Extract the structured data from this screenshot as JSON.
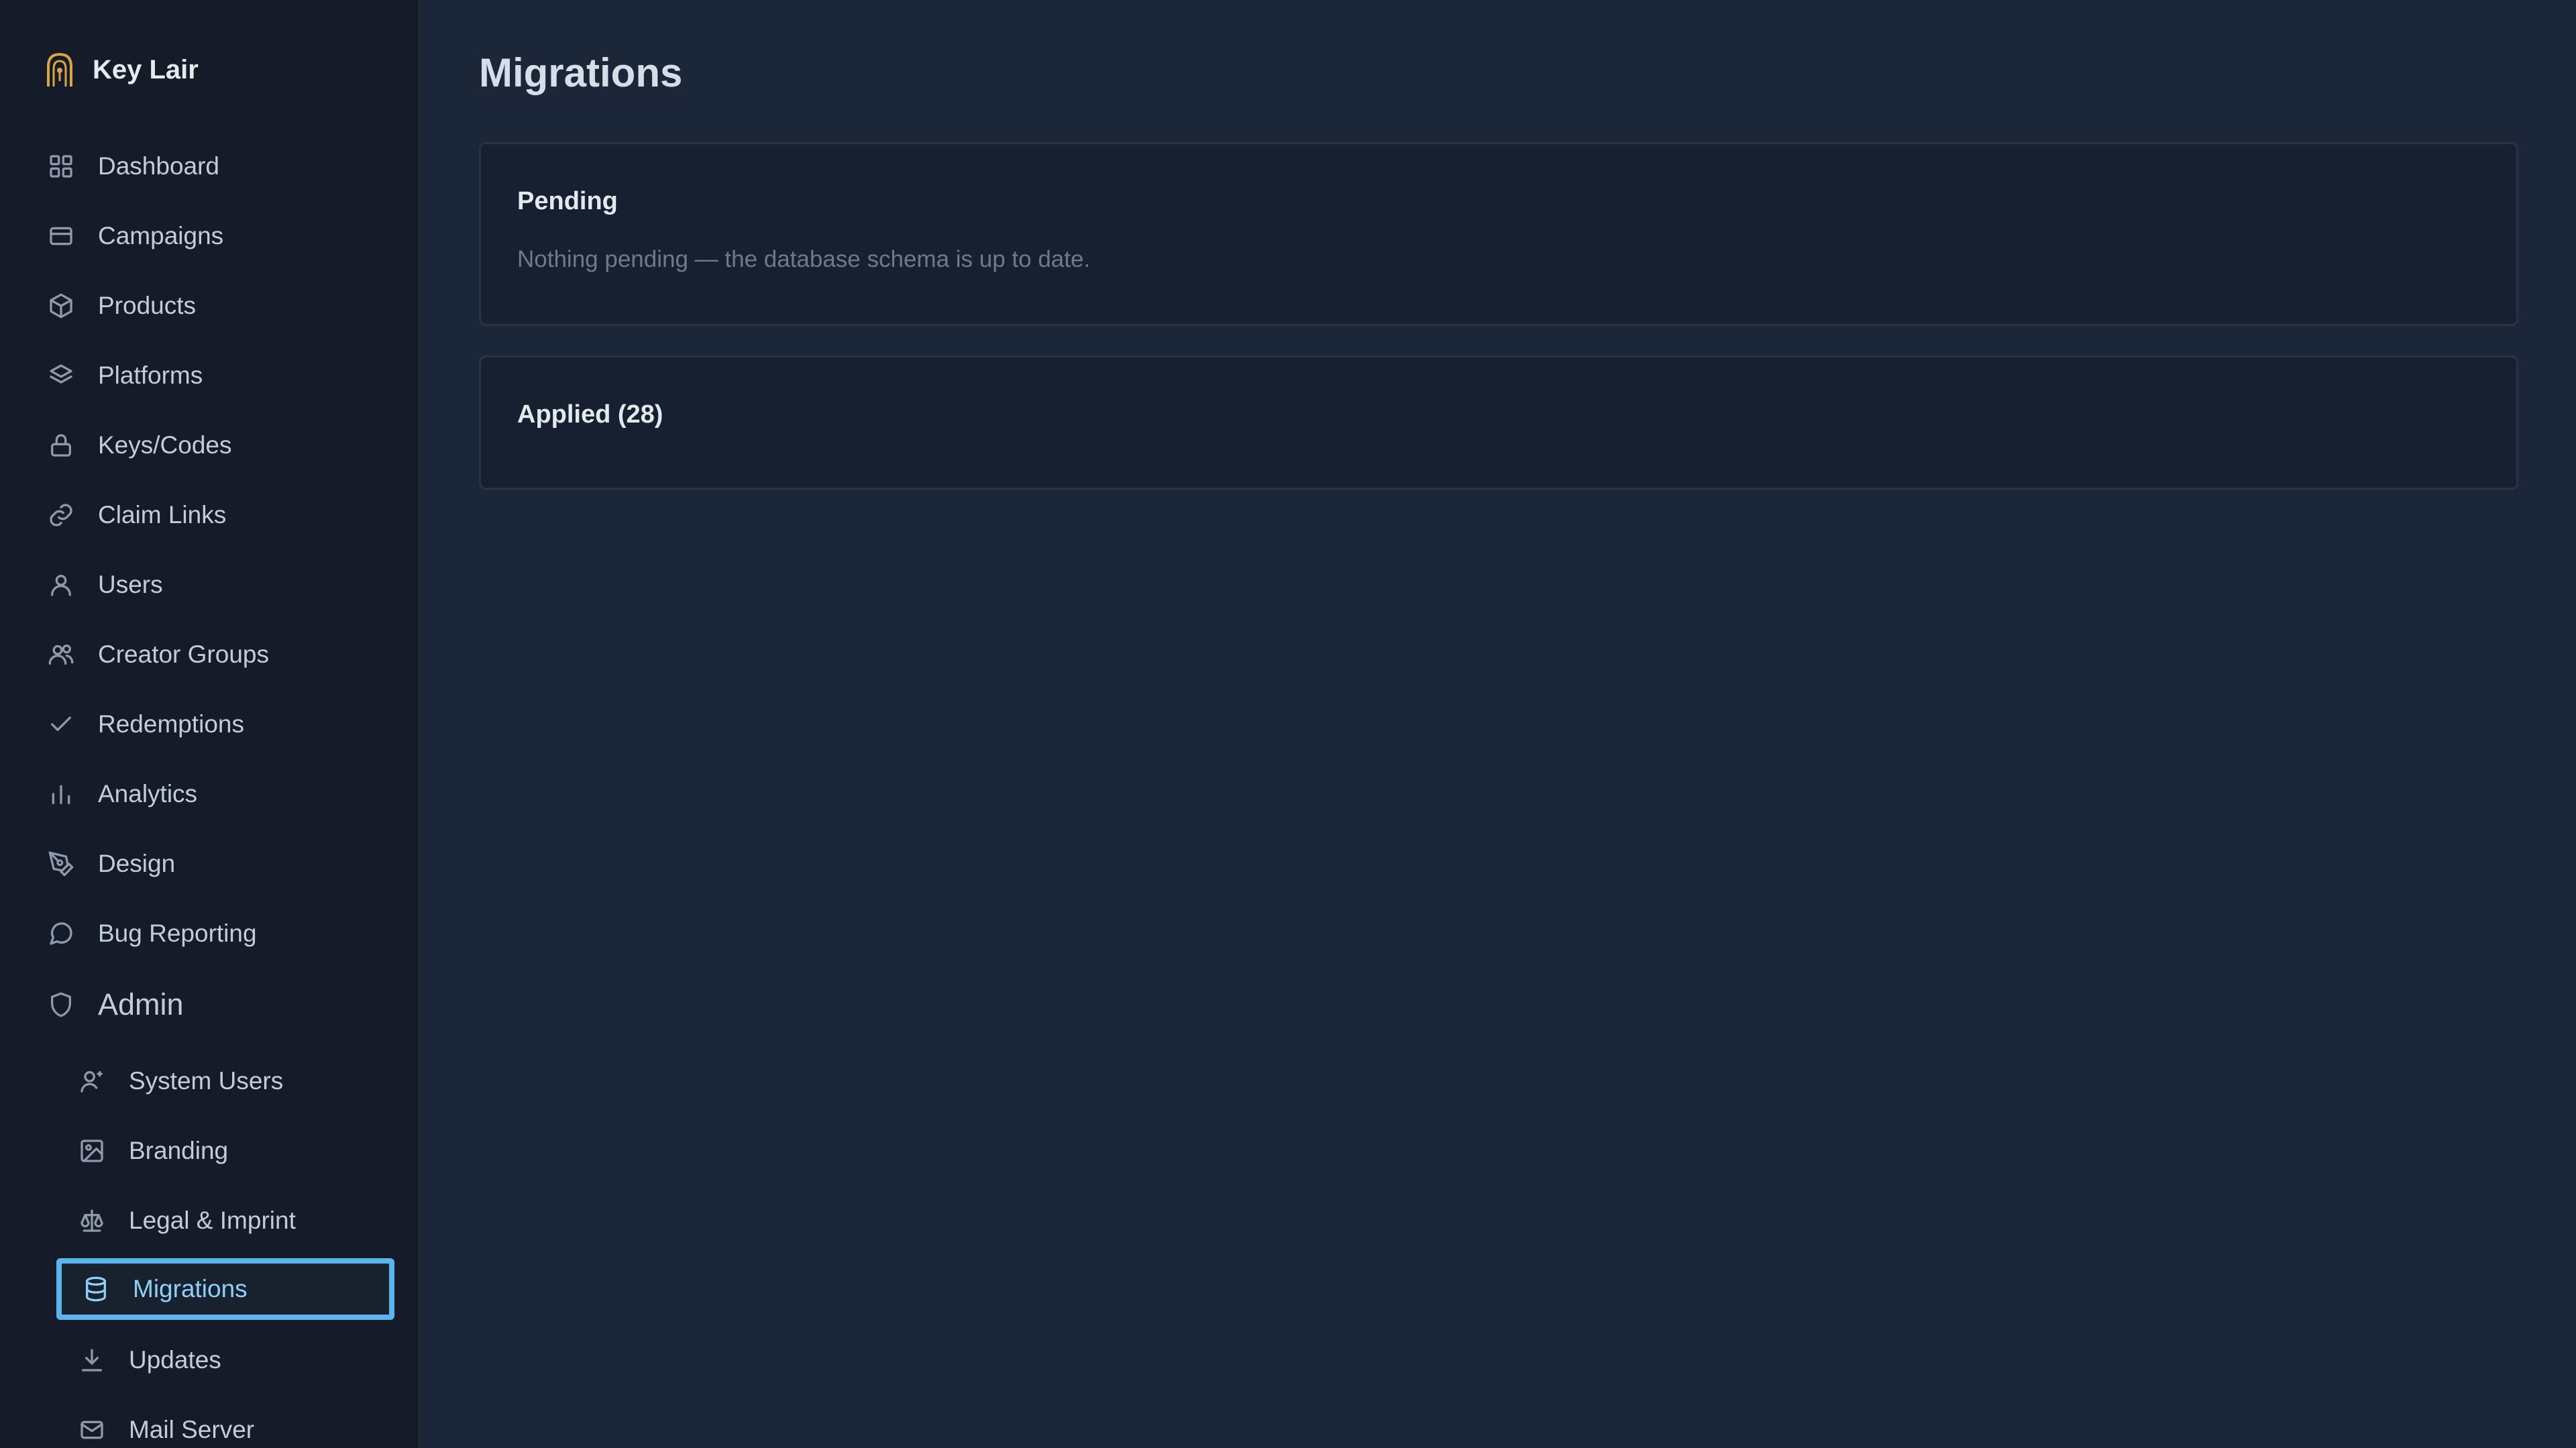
{
  "app": {
    "name": "Key Lair"
  },
  "sidebar": {
    "items": [
      {
        "label": "Dashboard",
        "icon": "dashboard-grid-icon"
      },
      {
        "label": "Campaigns",
        "icon": "card-icon"
      },
      {
        "label": "Products",
        "icon": "package-icon"
      },
      {
        "label": "Platforms",
        "icon": "layers-icon"
      },
      {
        "label": "Keys/Codes",
        "icon": "lock-icon"
      },
      {
        "label": "Claim Links",
        "icon": "link-icon"
      },
      {
        "label": "Users",
        "icon": "user-icon"
      },
      {
        "label": "Creator Groups",
        "icon": "users-icon"
      },
      {
        "label": "Redemptions",
        "icon": "check-icon"
      },
      {
        "label": "Analytics",
        "icon": "bar-chart-icon"
      },
      {
        "label": "Design",
        "icon": "pen-tool-icon"
      },
      {
        "label": "Bug Reporting",
        "icon": "message-circle-icon"
      }
    ],
    "admin": {
      "label": "Admin",
      "icon": "shield-icon"
    },
    "admin_items": [
      {
        "label": "System Users",
        "icon": "user-cog-icon"
      },
      {
        "label": "Branding",
        "icon": "image-icon"
      },
      {
        "label": "Legal & Imprint",
        "icon": "scale-icon"
      },
      {
        "label": "Migrations",
        "icon": "database-icon",
        "active": true
      },
      {
        "label": "Updates",
        "icon": "download-icon"
      },
      {
        "label": "Mail Server",
        "icon": "mail-icon"
      }
    ]
  },
  "main": {
    "title": "Migrations",
    "pending": {
      "title": "Pending",
      "message": "Nothing pending — the database schema is up to date."
    },
    "applied": {
      "title": "Applied (28)"
    }
  },
  "colors": {
    "accent": "#5db4ec",
    "sidebar_bg": "#161c27",
    "main_bg": "#1b2638",
    "card_bg": "#172030"
  }
}
